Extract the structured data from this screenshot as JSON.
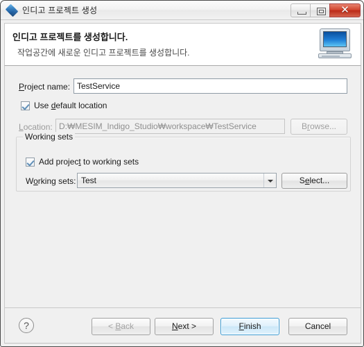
{
  "window": {
    "title": "인디고 프로젝트 생성",
    "app_icon": "eclipse-diamond-icon",
    "controls": {
      "minimize": "minimize-icon",
      "maximize": "maximize-icon",
      "close": "✕"
    }
  },
  "header": {
    "title": "인디고 프로젝트를 생성합니다.",
    "description": "작업공간에 새로운 인디고 프로젝트를 생성합니다.",
    "icon": "computer-monitor-icon"
  },
  "form": {
    "project_name_label": "Project name:",
    "project_name_label_mnemonic": "P",
    "project_name_value": "TestService",
    "use_default_location": {
      "label_before": "Use ",
      "label_mnemonic": "d",
      "label_after": "efault location",
      "checked": true
    },
    "location_label": "Location:",
    "location_label_mnemonic": "L",
    "location_value": "D:\\MESIM_Indigo_Studio\\workspace\\TestService",
    "location_display_value": "D:₩MESIM_Indigo_Studio₩workspace₩TestService",
    "location_enabled": false,
    "browse_button": "Browse...",
    "browse_button_mnemonic": "r",
    "browse_enabled": false
  },
  "working_sets": {
    "group_title": "Working sets",
    "add_checkbox": {
      "label_before": "Add projec",
      "label_mnemonic": "t",
      "label_after": " to working sets",
      "checked": true
    },
    "combo_label_before": "W",
    "combo_label_mnemonic": "o",
    "combo_label_after": "rking sets:",
    "combo_value": "Test",
    "select_button_before": "S",
    "select_button_mnemonic": "e",
    "select_button_after": "lect..."
  },
  "footer": {
    "help_glyph": "?",
    "help_name": "help-icon",
    "back": {
      "before": "< ",
      "mnemonic": "B",
      "after": "ack",
      "enabled": false
    },
    "next": {
      "before": "",
      "mnemonic": "N",
      "after": "ext >",
      "enabled": true
    },
    "finish": {
      "before": "",
      "mnemonic": "F",
      "after": "inish",
      "enabled": true,
      "is_default": true
    },
    "cancel": {
      "before": "Cancel",
      "mnemonic": "",
      "after": "",
      "enabled": true
    }
  },
  "colors": {
    "window_bg": "#f0f0f0",
    "header_bg": "#ffffff",
    "accent_blue": "#3c9cd4",
    "close_red": "#d1452f",
    "disabled_text": "#9a9a9a"
  }
}
